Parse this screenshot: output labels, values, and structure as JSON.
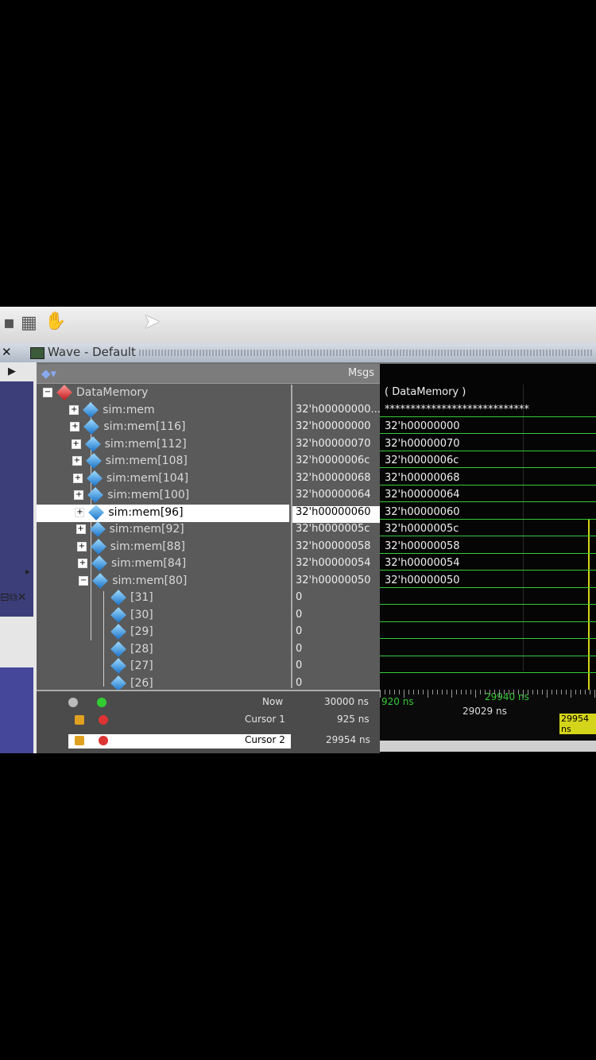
{
  "window": {
    "title": "Wave - Default"
  },
  "header": {
    "msgs_label": "Msgs"
  },
  "signals": [
    {
      "name": "DataMemory",
      "value": "",
      "wave": "( DataMemory )",
      "expander": "−",
      "icon": "red-diamond-icon"
    },
    {
      "name": "sim:mem",
      "value": "32'h00000000...",
      "wave": "****************************",
      "expander": "+",
      "icon": "blue-diamond-icon"
    },
    {
      "name": "sim:mem[116]",
      "value": "32'h00000000",
      "wave": "32'h00000000",
      "expander": "+",
      "icon": "blue-diamond-icon"
    },
    {
      "name": "sim:mem[112]",
      "value": "32'h00000070",
      "wave": "32'h00000070",
      "expander": "+",
      "icon": "blue-diamond-icon"
    },
    {
      "name": "sim:mem[108]",
      "value": "32'h0000006c",
      "wave": "32'h0000006c",
      "expander": "+",
      "icon": "blue-diamond-icon"
    },
    {
      "name": "sim:mem[104]",
      "value": "32'h00000068",
      "wave": "32'h00000068",
      "expander": "+",
      "icon": "blue-diamond-icon"
    },
    {
      "name": "sim:mem[100]",
      "value": "32'h00000064",
      "wave": "32'h00000064",
      "expander": "+",
      "icon": "blue-diamond-icon"
    },
    {
      "name": "sim:mem[96]",
      "value": "32'h00000060",
      "wave": "32'h00000060",
      "expander": "+",
      "icon": "blue-diamond-icon",
      "selected": true
    },
    {
      "name": "sim:mem[92]",
      "value": "32'h0000005c",
      "wave": "32'h0000005c",
      "expander": "+",
      "icon": "blue-diamond-icon"
    },
    {
      "name": "sim:mem[88]",
      "value": "32'h00000058",
      "wave": "32'h00000058",
      "expander": "+",
      "icon": "blue-diamond-icon"
    },
    {
      "name": "sim:mem[84]",
      "value": "32'h00000054",
      "wave": "32'h00000054",
      "expander": "+",
      "icon": "blue-diamond-icon"
    },
    {
      "name": "sim:mem[80]",
      "value": "32'h00000050",
      "wave": "32'h00000050",
      "expander": "−",
      "icon": "blue-diamond-icon"
    },
    {
      "name": "[31]",
      "value": "0",
      "wave": "",
      "expander": "",
      "icon": "blue-diamond-icon"
    },
    {
      "name": "[30]",
      "value": "0",
      "wave": "",
      "expander": "",
      "icon": "blue-diamond-icon"
    },
    {
      "name": "[29]",
      "value": "0",
      "wave": "",
      "expander": "",
      "icon": "blue-diamond-icon"
    },
    {
      "name": "[28]",
      "value": "0",
      "wave": "",
      "expander": "",
      "icon": "blue-diamond-icon"
    },
    {
      "name": "[27]",
      "value": "0",
      "wave": "",
      "expander": "",
      "icon": "blue-diamond-icon"
    },
    {
      "name": "[26]",
      "value": "0",
      "wave": "",
      "expander": "",
      "icon": "blue-diamond-icon"
    }
  ],
  "status": {
    "now_label": "Now",
    "now_value": "30000 ns",
    "cursor1_label": "Cursor 1",
    "cursor1_value": "925 ns",
    "cursor2_label": "Cursor 2",
    "cursor2_value": "29954 ns"
  },
  "ruler": {
    "left_time": "920 ns",
    "mid_time": "29940 ns",
    "delta_time": "29029 ns",
    "cursor_tag": "29954 ns"
  },
  "colors": {
    "wave_green": "#37c837",
    "cursor_yellow": "#d4d41a",
    "selection": "#ffffff"
  }
}
